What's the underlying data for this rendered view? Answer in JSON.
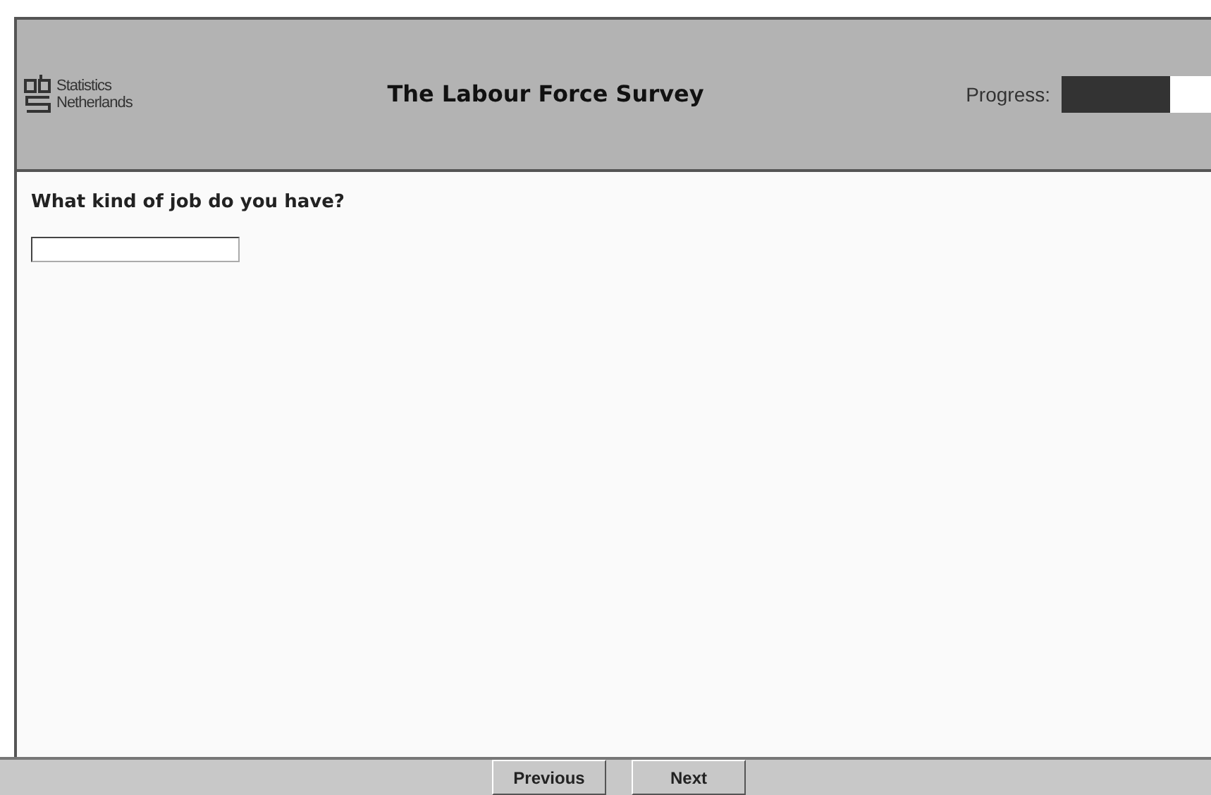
{
  "header": {
    "logo_text": [
      "Statistics",
      "Netherlands"
    ],
    "title": "The Labour Force Survey",
    "progress": {
      "label": "Progress:",
      "level": 0.73
    }
  },
  "question": {
    "text": "What kind of job do you have?"
  },
  "buttons": [
    "Previous",
    "Next"
  ]
}
